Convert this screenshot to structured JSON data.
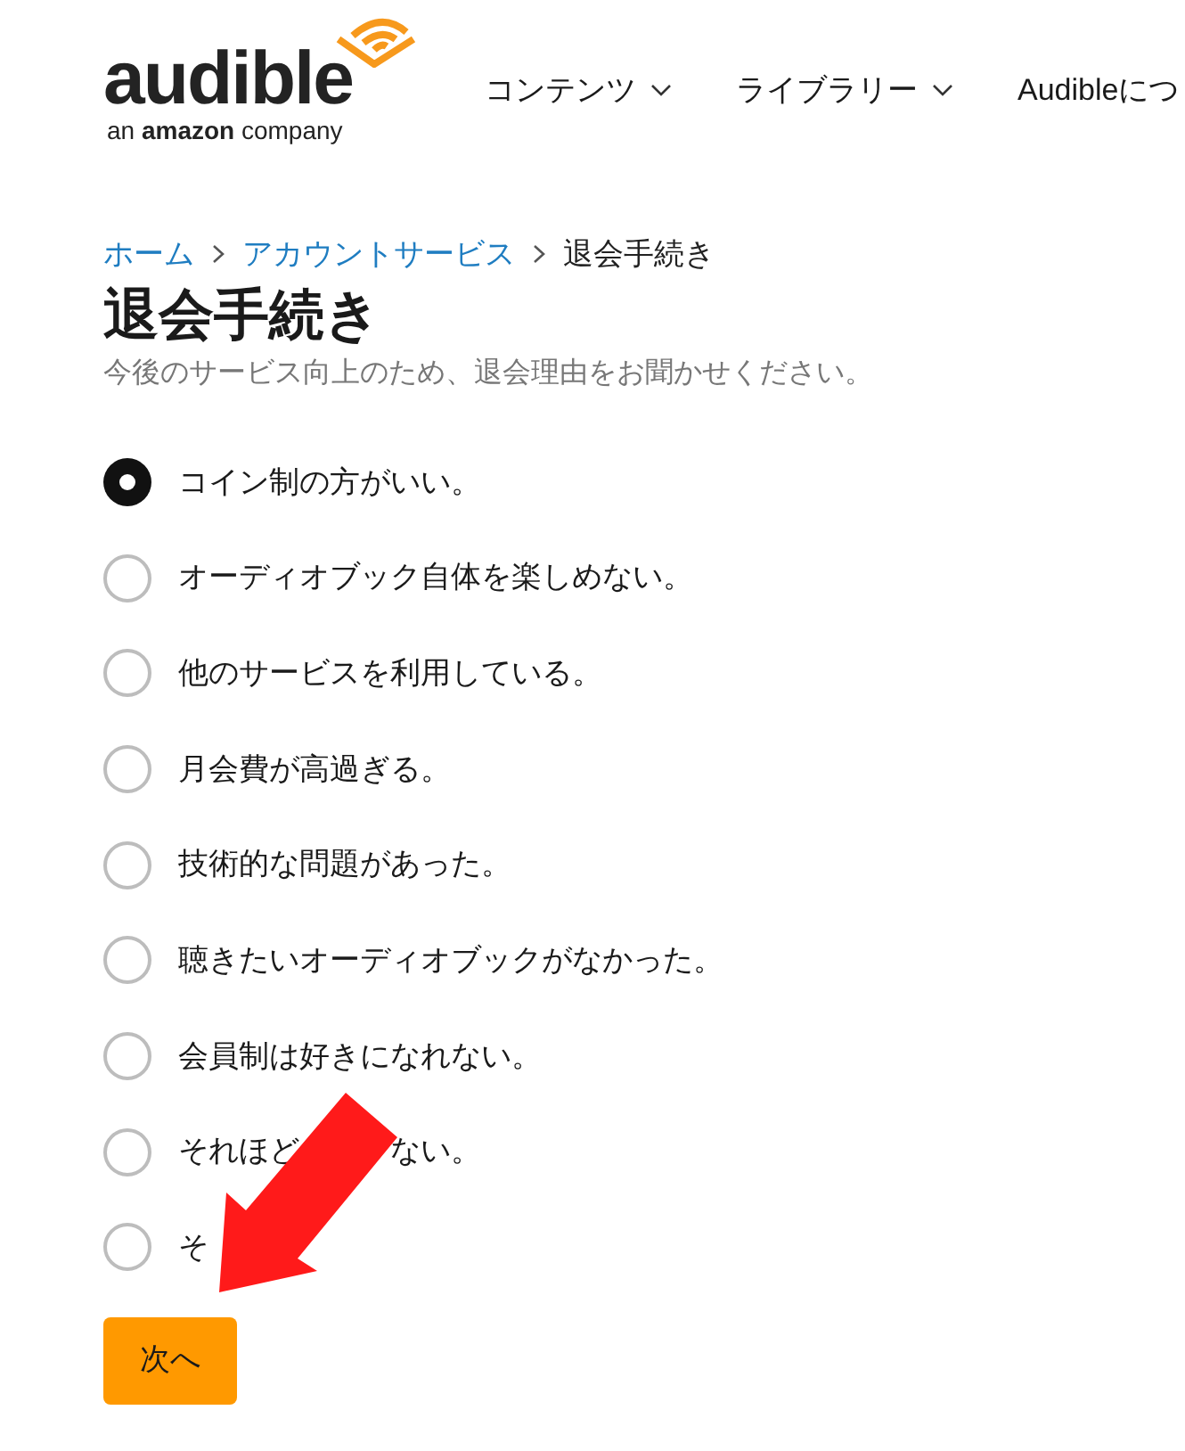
{
  "header": {
    "logo": {
      "wordmark": "audible",
      "tagline_prefix": "an",
      "tagline_brand": "amazon",
      "tagline_suffix": "company"
    },
    "nav": [
      {
        "label": "コンテンツ",
        "dropdown": true
      },
      {
        "label": "ライブラリー",
        "dropdown": true
      },
      {
        "label": "Audibleにつ",
        "dropdown": false
      }
    ]
  },
  "breadcrumb": [
    {
      "label": "ホーム",
      "link": true
    },
    {
      "label": "アカウントサービス",
      "link": true
    },
    {
      "label": "退会手続き",
      "link": false
    }
  ],
  "title": "退会手続き",
  "subtitle": "今後のサービス向上のため、退会理由をお聞かせください。",
  "options": [
    {
      "label_parts": [
        "コイン制の方がいい。"
      ],
      "selected": true
    },
    {
      "label_parts": [
        "オーディオブック自体を楽しめない。"
      ],
      "selected": false
    },
    {
      "label_parts": [
        "他のサービスを利用している。"
      ],
      "selected": false
    },
    {
      "label_parts": [
        "月会費が高過ぎる。"
      ],
      "selected": false
    },
    {
      "label_parts": [
        "技術的な問題があった。"
      ],
      "selected": false
    },
    {
      "label_parts": [
        "聴きたいオーディオブックがなかった。"
      ],
      "selected": false
    },
    {
      "label_parts": [
        "会員制は好きになれない。"
      ],
      "selected": false
    },
    {
      "label_parts": [
        "それほど",
        "ない。"
      ],
      "selected": false
    },
    {
      "label_parts": [
        "そ"
      ],
      "selected": false
    }
  ],
  "next_button": "次へ"
}
